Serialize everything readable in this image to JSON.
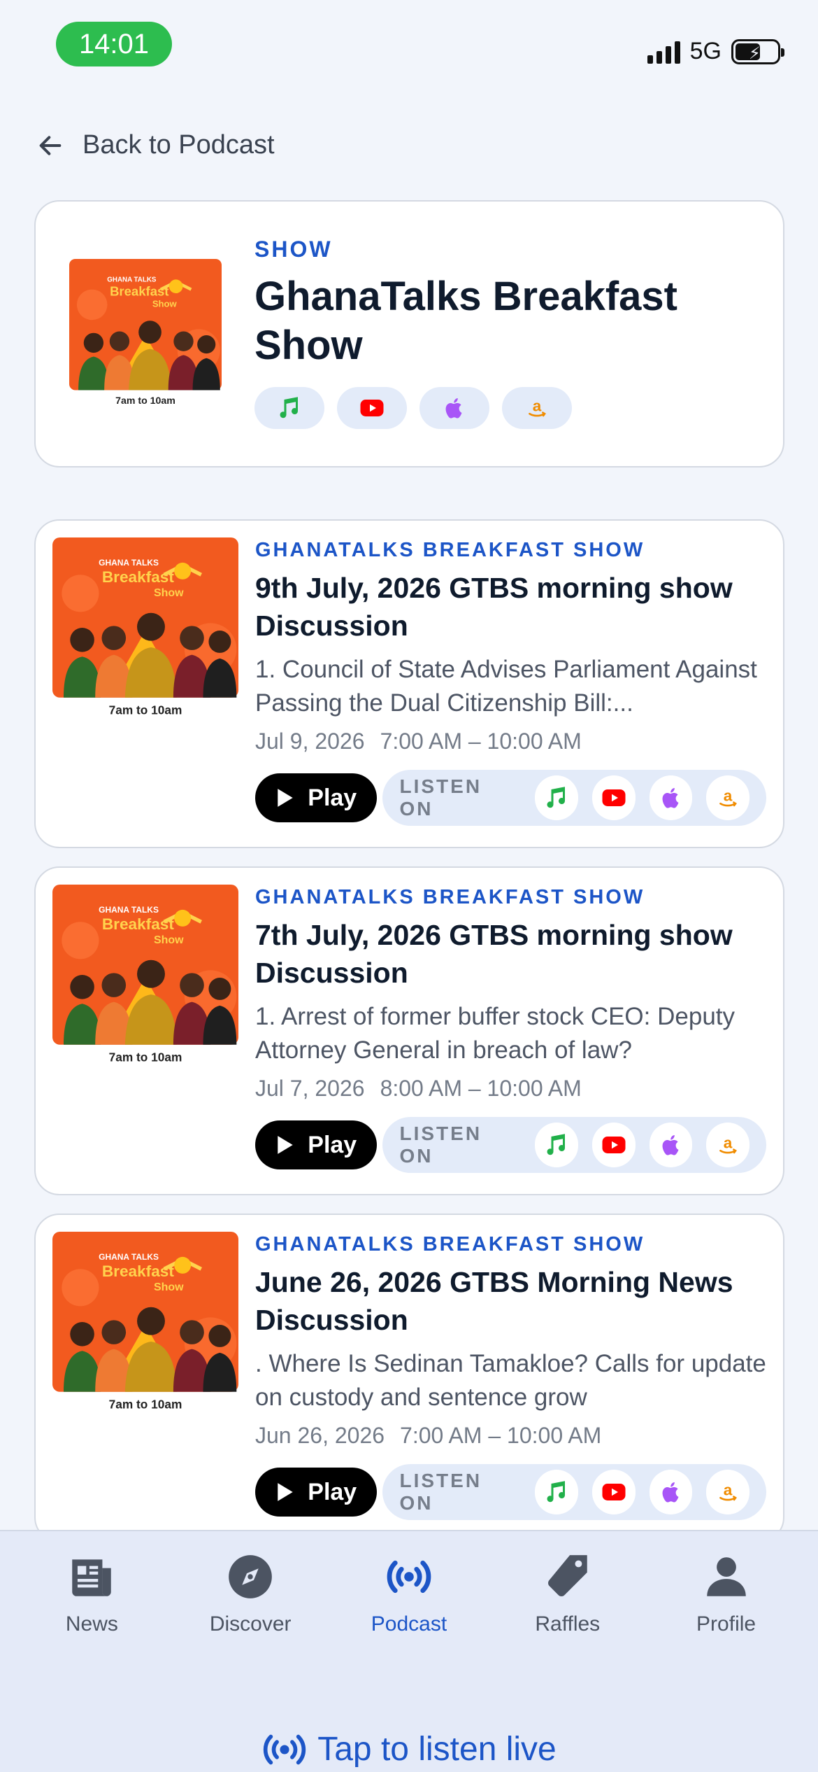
{
  "status": {
    "time": "14:01",
    "network": "5G"
  },
  "back_label": "Back to Podcast",
  "show": {
    "eyebrow": "SHOW",
    "title": "GhanaTalks Breakfast Show",
    "cover_caption": "7am to 10am",
    "cover_title_top": "GHANA TALKS",
    "cover_title_main": "Breakfast",
    "cover_title_sub": "Show"
  },
  "listen_on_label": "LISTEN ON",
  "play_label": "Play",
  "episodes": [
    {
      "show": "GHANATALKS BREAKFAST SHOW",
      "title": "9th July, 2026  GTBS morning show Discussion",
      "desc": "1. Council of State Advises Parliament Against Passing the Dual Citizenship Bill:...",
      "date": "Jul 9, 2026",
      "time": "7:00 AM – 10:00 AM"
    },
    {
      "show": "GHANATALKS BREAKFAST SHOW",
      "title": "7th July, 2026  GTBS morning show Discussion",
      "desc": "1. Arrest of former buffer stock CEO: Deputy Attorney General in breach of law?",
      "date": "Jul 7, 2026",
      "time": "8:00 AM – 10:00 AM"
    },
    {
      "show": "GHANATALKS BREAKFAST SHOW",
      "title": "June 26, 2026 GTBS Morning News Discussion",
      "desc": ". Where Is Sedinan Tamakloe? Calls for update on custody and sentence grow",
      "date": "Jun 26, 2026",
      "time": "7:00 AM – 10:00 AM"
    }
  ],
  "tabs": [
    {
      "label": "News",
      "icon": "newspaper-icon"
    },
    {
      "label": "Discover",
      "icon": "compass-icon"
    },
    {
      "label": "Podcast",
      "icon": "broadcast-icon",
      "active": true
    },
    {
      "label": "Raffles",
      "icon": "tag-icon"
    },
    {
      "label": "Profile",
      "icon": "person-icon"
    }
  ],
  "live_label": "Tap to listen live",
  "colors": {
    "accent": "#1c55c7",
    "status_green": "#2dbd4f",
    "cover_orange": "#f25a1f"
  }
}
